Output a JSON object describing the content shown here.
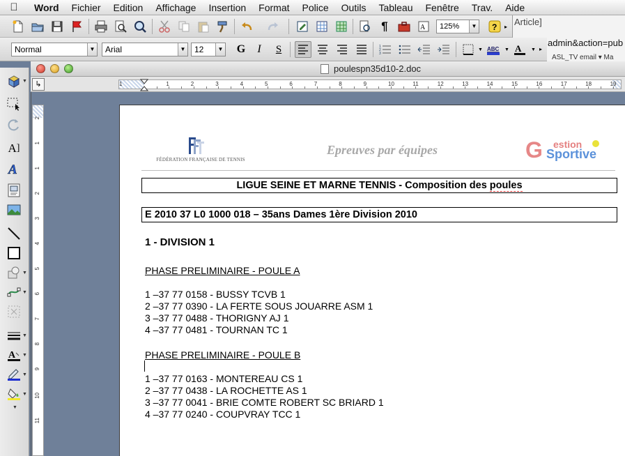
{
  "menubar": {
    "app": "Word",
    "items": [
      "Fichier",
      "Edition",
      "Affichage",
      "Insertion",
      "Format",
      "Police",
      "Outils",
      "Tableau",
      "Fenêtre",
      "Trav.",
      "Aide"
    ]
  },
  "toolbar": {
    "zoom": "125%",
    "style": "Normal",
    "font": "Arial",
    "size": "12",
    "bold_label": "G",
    "italic_label": "I",
    "underline_label": "S"
  },
  "background_window": {
    "line1": "Article]",
    "line2": "admin&action=pub",
    "line3": "ASL_TV  email ▾    Ma"
  },
  "window": {
    "title": "poulespn35d10-2.doc"
  },
  "ruler": {
    "h_numbers": [
      "1",
      "1",
      "2",
      "3",
      "4",
      "5",
      "6",
      "7",
      "8",
      "9",
      "10",
      "11",
      "12",
      "13",
      "14",
      "15",
      "16",
      "17",
      "18",
      "19"
    ],
    "v_numbers": [
      "2",
      "1",
      "1",
      "2",
      "3",
      "4",
      "5",
      "6",
      "7",
      "8",
      "9",
      "10",
      "11"
    ]
  },
  "document": {
    "header": {
      "federation": "FÉDÉRATION FRANÇAISE DE TENNIS",
      "title": "Epreuves par équipes",
      "logo_right_1": "G",
      "logo_right_2": "estion",
      "logo_right_3": "Sportive"
    },
    "box1": {
      "text_a": "LIGUE SEINE ET MARNE TENNIS - Composition des ",
      "text_b": "poules"
    },
    "box2": "E 2010  37  L0  1000  018  – 35ans  Dames  1ère  Division  2010",
    "division": "1 - DIVISION  1",
    "poule_a": {
      "heading": "PHASE PRELIMINAIRE - POULE A",
      "teams": [
        "1 –37 77 0158 - BUSSY TCVB 1",
        "2 –37 77 0390 - LA FERTE SOUS JOUARRE ASM 1",
        "3 –37 77 0488 - THORIGNY AJ 1",
        "4 –37 77 0481 - TOURNAN TC 1"
      ]
    },
    "poule_b": {
      "heading": "PHASE PRELIMINAIRE - POULE B",
      "teams": [
        "1 –37 77 0163 - MONTEREAU CS 1",
        "2 –37 77 0438 - LA ROCHETTE AS 1",
        "3 –37 77 0041 - BRIE COMTE ROBERT SC BRIARD 1",
        "4 –37 77 0240 - COUPVRAY TCC 1"
      ]
    }
  }
}
